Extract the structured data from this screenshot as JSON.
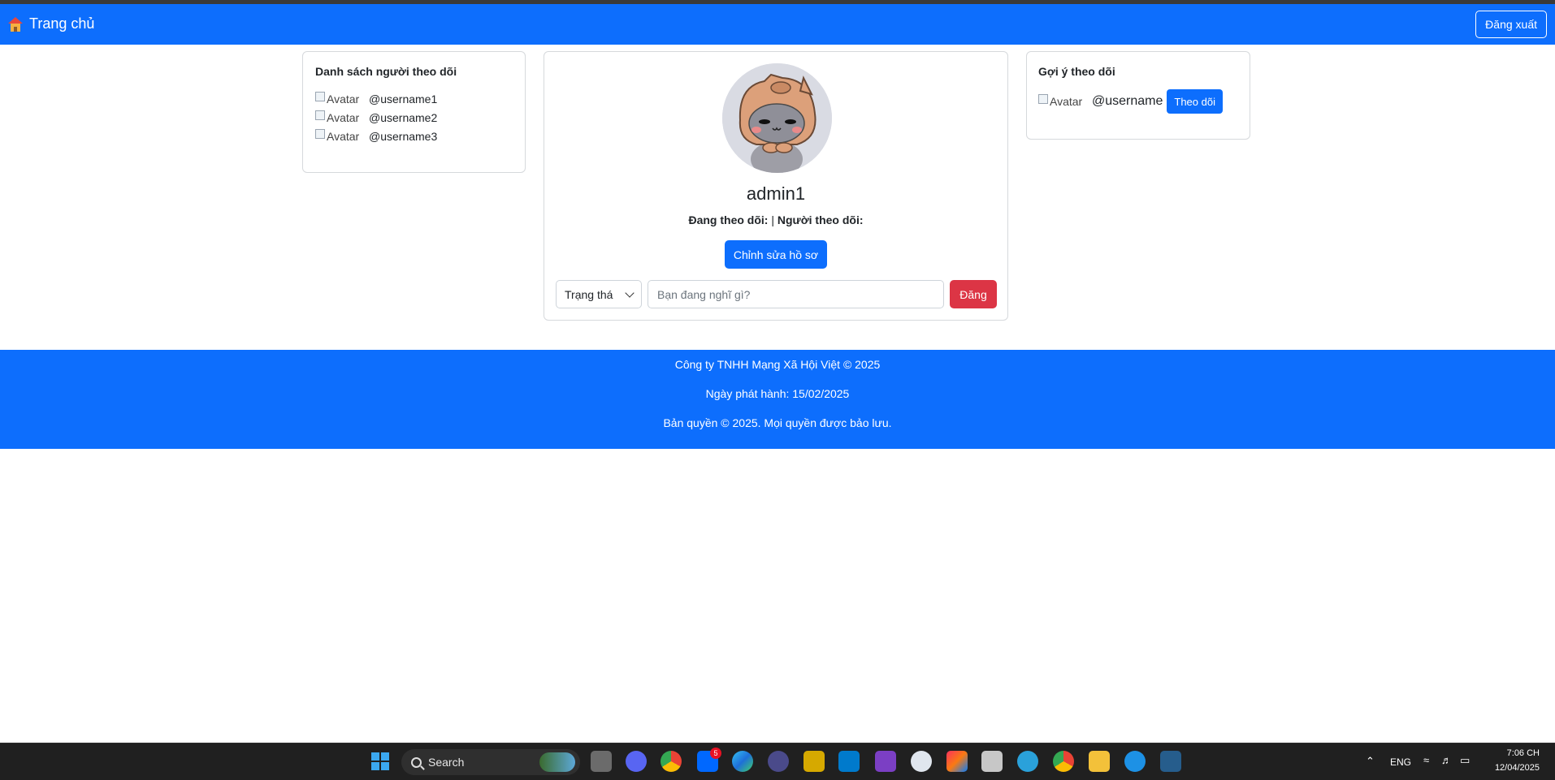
{
  "navbar": {
    "brand": "Trang chủ",
    "logout": "Đăng xuất",
    "color": "#0d6efd"
  },
  "followers": {
    "title": "Danh sách người theo dõi",
    "items": [
      {
        "alt": "Avatar",
        "username": "@username1"
      },
      {
        "alt": "Avatar",
        "username": "@username2"
      },
      {
        "alt": "Avatar",
        "username": "@username3"
      }
    ]
  },
  "profile": {
    "username": "admin1",
    "following_label": "Đang theo dõi:",
    "separator": "|",
    "followers_label": "Người theo dõi:",
    "edit_button": "Chỉnh sửa hồ sơ",
    "status_select": "Trạng thá",
    "post_placeholder": "Bạn đang nghĩ gì?",
    "post_button": "Đăng"
  },
  "suggestions": {
    "title": "Gợi ý theo dõi",
    "items": [
      {
        "alt": "Avatar",
        "username": "@username",
        "button": "Theo dõi"
      }
    ]
  },
  "footer": {
    "company": "Công ty TNHH Mạng Xã Hội Việt © 2025",
    "release": "Ngày phát hành: 15/02/2025",
    "copyright": "Bản quyền © 2025. Mọi quyền được bảo lưu."
  },
  "taskbar": {
    "search": "Search",
    "zalo_badge": "5",
    "lang": "ENG",
    "time": "7:06 CH",
    "date": "12/04/2025",
    "apps": [
      "start-icon",
      "search-icon",
      "task-view-icon",
      "discord-icon",
      "chrome-icon",
      "zalo-icon",
      "edge-icon",
      "app-icon",
      "app-icon",
      "vscode-icon",
      "visual-studio-icon",
      "android-studio-icon",
      "intellij-icon",
      "file-manager-icon",
      "telegram-icon",
      "chrome-active-icon",
      "explorer-icon",
      "docker-icon",
      "mysql-workbench-icon"
    ]
  }
}
